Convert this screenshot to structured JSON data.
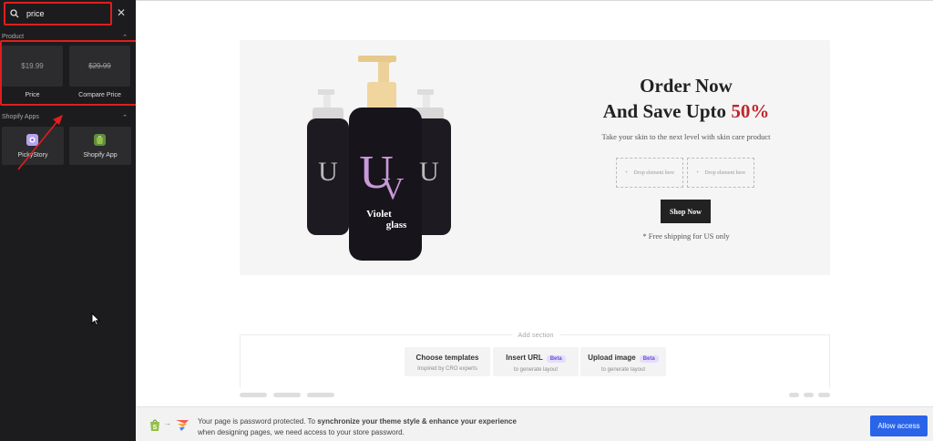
{
  "sidebar": {
    "search": {
      "value": "price",
      "placeholder": ""
    },
    "groups": {
      "product": {
        "title": "Product",
        "items": [
          {
            "label": "Price",
            "preview": "$19.99"
          },
          {
            "label": "Compare Price",
            "preview": "$29.99"
          }
        ]
      },
      "shopify_apps": {
        "title": "Shopify Apps",
        "items": [
          {
            "label": "PickyStory",
            "icon": "pickystory-icon"
          },
          {
            "label": "Shopify App",
            "icon": "shopify-bag-icon"
          }
        ]
      }
    }
  },
  "banner": {
    "product_brand": "Violet glass",
    "title_line1": "Order Now",
    "title_line2_prefix": "And Save Upto ",
    "title_line2_highlight": "50%",
    "tagline": "Take your skin to the next level with skin care product",
    "drop_placeholder": "Drop element here",
    "shop_button": "Shop Now",
    "shipping": "* Free shipping for US only"
  },
  "add_section": {
    "label": "Add section",
    "options": [
      {
        "title": "Choose templates",
        "subtitle": "Inspired by CRO experts",
        "badge": ""
      },
      {
        "title": "Insert URL",
        "subtitle": "to generate layout",
        "badge": "Beta"
      },
      {
        "title": "Upload image",
        "subtitle": "to generate layout",
        "badge": "Beta"
      }
    ]
  },
  "notice": {
    "text_prefix": "Your page is password protected. To ",
    "text_bold": "synchronize your theme style & enhance your experience",
    "text_line2": "when designing pages, we need access to your store password.",
    "button": "Allow access"
  },
  "colors": {
    "sidebar_bg": "#1c1c1e",
    "highlight": "#e01e1e",
    "accent_red": "#c0262d",
    "primary_button": "#2a64e8"
  }
}
